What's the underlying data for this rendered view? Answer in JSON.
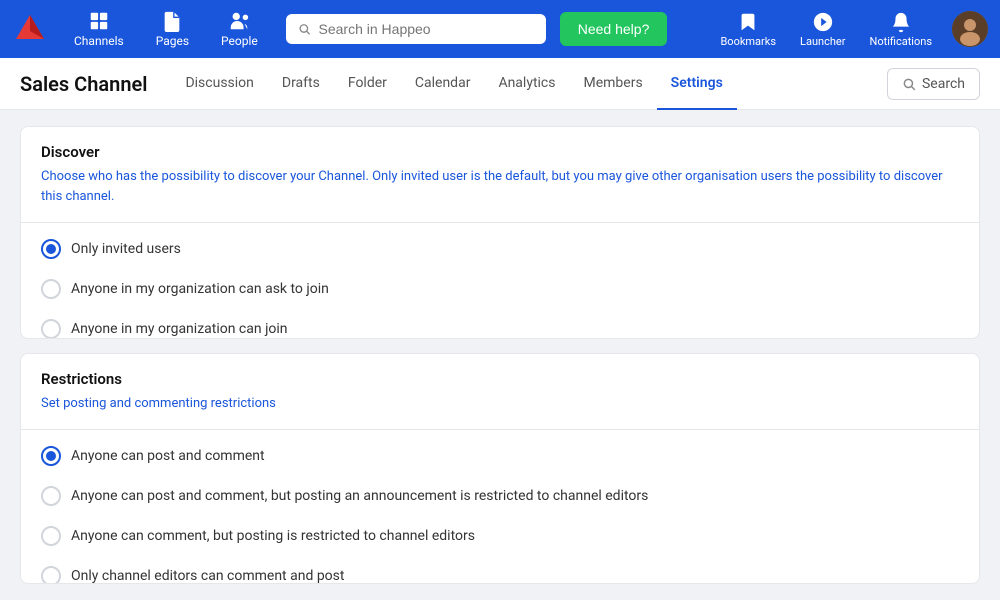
{
  "brand": {
    "logo_color": "#e53935",
    "name": "Happeo"
  },
  "top_nav": {
    "search_placeholder": "Search in Happeo",
    "need_help_label": "Need help?",
    "items": [
      {
        "id": "channels",
        "label": "Channels",
        "icon": "⊞"
      },
      {
        "id": "pages",
        "label": "Pages",
        "icon": "📄"
      },
      {
        "id": "people",
        "label": "People",
        "icon": "👤"
      }
    ],
    "right_items": [
      {
        "id": "bookmarks",
        "label": "Bookmarks",
        "icon": "🔖"
      },
      {
        "id": "launcher",
        "label": "Launcher",
        "icon": "🚀"
      },
      {
        "id": "notifications",
        "label": "Notifications",
        "icon": "🔔"
      }
    ]
  },
  "sub_nav": {
    "page_title": "Sales Channel",
    "tabs": [
      {
        "id": "discussion",
        "label": "Discussion",
        "active": false
      },
      {
        "id": "drafts",
        "label": "Drafts",
        "active": false
      },
      {
        "id": "folder",
        "label": "Folder",
        "active": false
      },
      {
        "id": "calendar",
        "label": "Calendar",
        "active": false
      },
      {
        "id": "analytics",
        "label": "Analytics",
        "active": false
      },
      {
        "id": "members",
        "label": "Members",
        "active": false
      },
      {
        "id": "settings",
        "label": "Settings",
        "active": true
      }
    ],
    "search_label": "Search"
  },
  "discover_card": {
    "title": "Discover",
    "description": "Choose who has the possibility to discover your Channel. Only invited user is the default, but you may give other organisation users the possibility to discover this channel.",
    "options": [
      {
        "id": "only-invited",
        "label": "Only invited users",
        "selected": true
      },
      {
        "id": "ask-to-join",
        "label": "Anyone in my organization can ask to join",
        "selected": false
      },
      {
        "id": "anyone-join",
        "label": "Anyone in my organization can join",
        "selected": false
      }
    ]
  },
  "restrictions_card": {
    "title": "Restrictions",
    "description": "Set posting and commenting restrictions",
    "options": [
      {
        "id": "anyone-post-comment",
        "label": "Anyone can post and comment",
        "selected": true
      },
      {
        "id": "restricted-announcement",
        "label": "Anyone can post and comment, but posting an announcement is restricted to channel editors",
        "selected": false
      },
      {
        "id": "restricted-posting",
        "label": "Anyone can comment, but posting is restricted to channel editors",
        "selected": false
      },
      {
        "id": "editors-only",
        "label": "Only channel editors can comment and post",
        "selected": false
      }
    ]
  }
}
